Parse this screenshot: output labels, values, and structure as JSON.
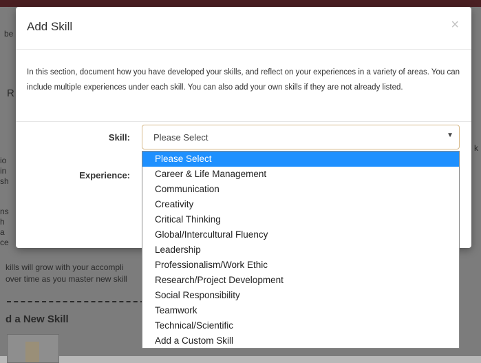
{
  "modal": {
    "title": "Add Skill",
    "close_glyph": "×",
    "intro": "In this section, document how you have developed your skills, and reflect on your experiences in a variety of areas. You can include multiple experiences under each skill. You can also add your own skills if they are not already listed.",
    "skill_label": "Skill:",
    "experience_label": "Experience:",
    "skill_select": {
      "value": "Please Select",
      "caret_icon": "caret-down-icon",
      "options": [
        "Please Select",
        "Career & Life Management",
        "Communication",
        "Creativity",
        "Critical Thinking",
        "Global/Intercultural Fluency",
        "Leadership",
        "Professionalism/Work Ethic",
        "Research/Project Development",
        "Social Responsibility",
        "Teamwork",
        "Technical/Scientific",
        "Add a Custom Skill"
      ],
      "highlighted_index": 0
    }
  },
  "background": {
    "frag1": "be",
    "frag2": "R",
    "frag3": "io",
    "frag4": "in",
    "frag5": "sh",
    "frag6": "ns",
    "frag7": "h",
    "frag8": "a",
    "frag9": "ce",
    "line1": "kills will grow with your accompli",
    "line2": "over time as you master new skill",
    "heading": "d a New Skill",
    "right_frag": "k"
  },
  "colors": {
    "highlight": "#1e90ff",
    "select_border": "#d7b98a",
    "topbar": "#4a1f22"
  }
}
